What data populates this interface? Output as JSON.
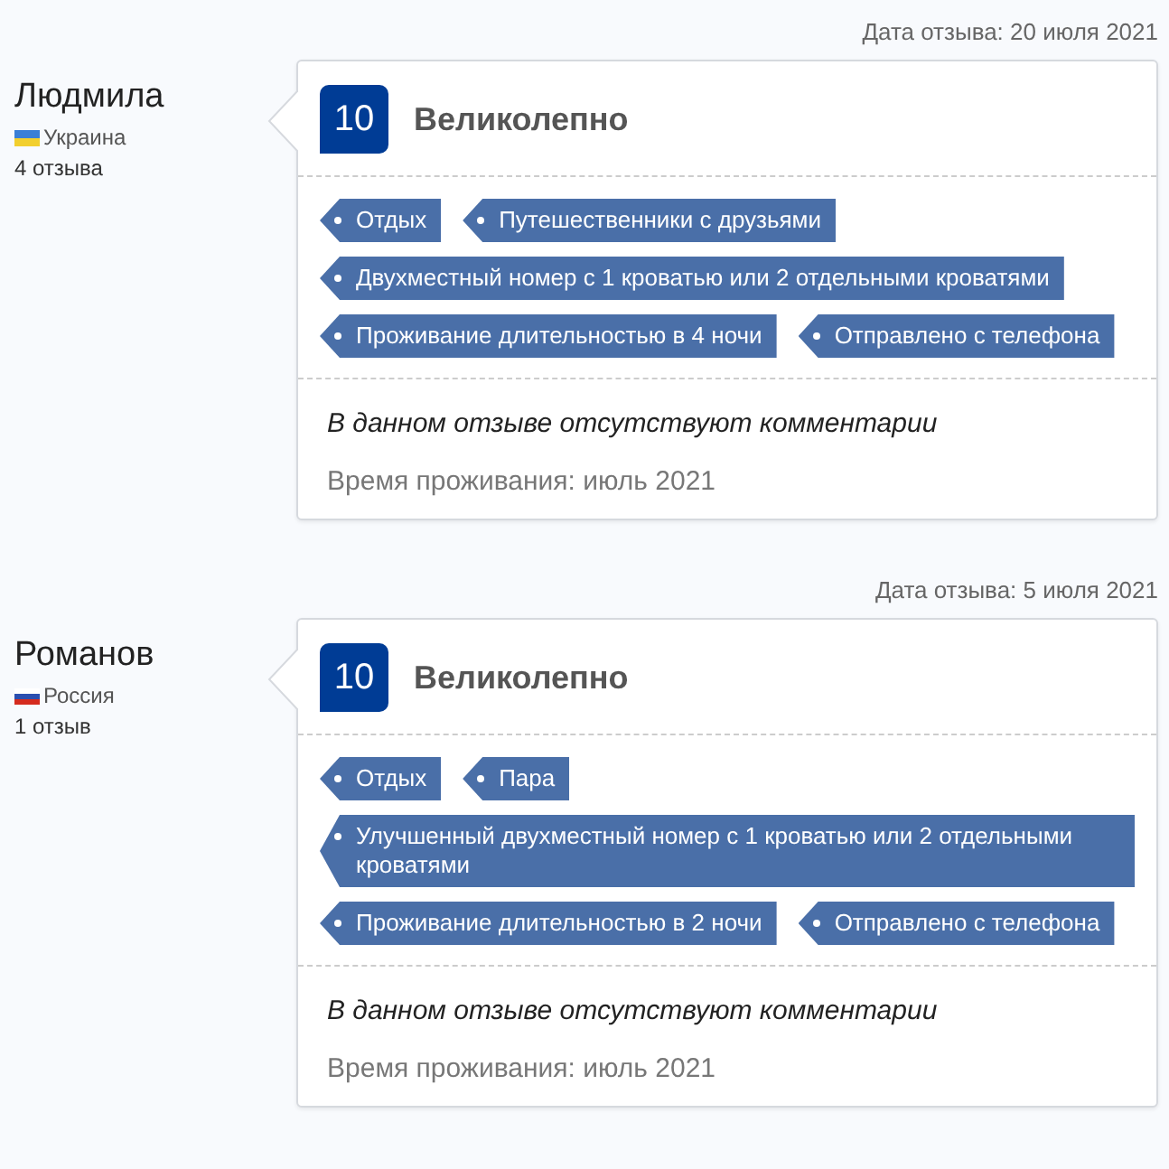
{
  "reviews": [
    {
      "date": "Дата отзыва: 20 июля 2021",
      "author": "Людмила",
      "country": {
        "kind": "ukraine",
        "name": "Украина"
      },
      "review_count": "4 отзыва",
      "score": "10",
      "verdict": "Великолепно",
      "tags": [
        "Отдых",
        "Путешественники с друзьями",
        "Двухместный номер с 1 кроватью или 2 отдельными кроватями",
        "Проживание длительностью в 4 ночи",
        "Отправлено с телефона"
      ],
      "comment": "В данном отзыве отсутствуют комментарии",
      "stay": "Время проживания: июль 2021"
    },
    {
      "date": "Дата отзыва: 5 июля 2021",
      "author": "Романов",
      "country": {
        "kind": "russia",
        "name": "Россия"
      },
      "review_count": "1 отзыв",
      "score": "10",
      "verdict": "Великолепно",
      "tags": [
        "Отдых",
        "Пара",
        "Улучшенный двухместный номер с 1 кроватью или 2 отдельными кроватями",
        "Проживание длительностью в 2 ночи",
        "Отправлено с телефона"
      ],
      "comment": "В данном отзыве отсутствуют комментарии",
      "stay": "Время проживания: июль 2021"
    }
  ]
}
